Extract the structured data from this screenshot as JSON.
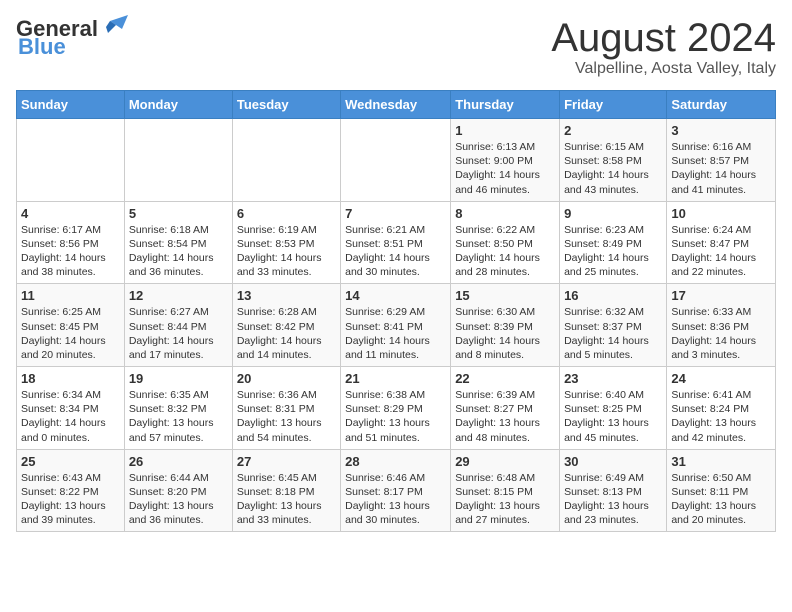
{
  "header": {
    "logo_general": "General",
    "logo_blue": "Blue",
    "month": "August 2024",
    "location": "Valpelline, Aosta Valley, Italy"
  },
  "days_of_week": [
    "Sunday",
    "Monday",
    "Tuesday",
    "Wednesday",
    "Thursday",
    "Friday",
    "Saturday"
  ],
  "weeks": [
    [
      {
        "num": "",
        "info": ""
      },
      {
        "num": "",
        "info": ""
      },
      {
        "num": "",
        "info": ""
      },
      {
        "num": "",
        "info": ""
      },
      {
        "num": "1",
        "info": "Sunrise: 6:13 AM\nSunset: 9:00 PM\nDaylight: 14 hours\nand 46 minutes."
      },
      {
        "num": "2",
        "info": "Sunrise: 6:15 AM\nSunset: 8:58 PM\nDaylight: 14 hours\nand 43 minutes."
      },
      {
        "num": "3",
        "info": "Sunrise: 6:16 AM\nSunset: 8:57 PM\nDaylight: 14 hours\nand 41 minutes."
      }
    ],
    [
      {
        "num": "4",
        "info": "Sunrise: 6:17 AM\nSunset: 8:56 PM\nDaylight: 14 hours\nand 38 minutes."
      },
      {
        "num": "5",
        "info": "Sunrise: 6:18 AM\nSunset: 8:54 PM\nDaylight: 14 hours\nand 36 minutes."
      },
      {
        "num": "6",
        "info": "Sunrise: 6:19 AM\nSunset: 8:53 PM\nDaylight: 14 hours\nand 33 minutes."
      },
      {
        "num": "7",
        "info": "Sunrise: 6:21 AM\nSunset: 8:51 PM\nDaylight: 14 hours\nand 30 minutes."
      },
      {
        "num": "8",
        "info": "Sunrise: 6:22 AM\nSunset: 8:50 PM\nDaylight: 14 hours\nand 28 minutes."
      },
      {
        "num": "9",
        "info": "Sunrise: 6:23 AM\nSunset: 8:49 PM\nDaylight: 14 hours\nand 25 minutes."
      },
      {
        "num": "10",
        "info": "Sunrise: 6:24 AM\nSunset: 8:47 PM\nDaylight: 14 hours\nand 22 minutes."
      }
    ],
    [
      {
        "num": "11",
        "info": "Sunrise: 6:25 AM\nSunset: 8:45 PM\nDaylight: 14 hours\nand 20 minutes."
      },
      {
        "num": "12",
        "info": "Sunrise: 6:27 AM\nSunset: 8:44 PM\nDaylight: 14 hours\nand 17 minutes."
      },
      {
        "num": "13",
        "info": "Sunrise: 6:28 AM\nSunset: 8:42 PM\nDaylight: 14 hours\nand 14 minutes."
      },
      {
        "num": "14",
        "info": "Sunrise: 6:29 AM\nSunset: 8:41 PM\nDaylight: 14 hours\nand 11 minutes."
      },
      {
        "num": "15",
        "info": "Sunrise: 6:30 AM\nSunset: 8:39 PM\nDaylight: 14 hours\nand 8 minutes."
      },
      {
        "num": "16",
        "info": "Sunrise: 6:32 AM\nSunset: 8:37 PM\nDaylight: 14 hours\nand 5 minutes."
      },
      {
        "num": "17",
        "info": "Sunrise: 6:33 AM\nSunset: 8:36 PM\nDaylight: 14 hours\nand 3 minutes."
      }
    ],
    [
      {
        "num": "18",
        "info": "Sunrise: 6:34 AM\nSunset: 8:34 PM\nDaylight: 14 hours\nand 0 minutes."
      },
      {
        "num": "19",
        "info": "Sunrise: 6:35 AM\nSunset: 8:32 PM\nDaylight: 13 hours\nand 57 minutes."
      },
      {
        "num": "20",
        "info": "Sunrise: 6:36 AM\nSunset: 8:31 PM\nDaylight: 13 hours\nand 54 minutes."
      },
      {
        "num": "21",
        "info": "Sunrise: 6:38 AM\nSunset: 8:29 PM\nDaylight: 13 hours\nand 51 minutes."
      },
      {
        "num": "22",
        "info": "Sunrise: 6:39 AM\nSunset: 8:27 PM\nDaylight: 13 hours\nand 48 minutes."
      },
      {
        "num": "23",
        "info": "Sunrise: 6:40 AM\nSunset: 8:25 PM\nDaylight: 13 hours\nand 45 minutes."
      },
      {
        "num": "24",
        "info": "Sunrise: 6:41 AM\nSunset: 8:24 PM\nDaylight: 13 hours\nand 42 minutes."
      }
    ],
    [
      {
        "num": "25",
        "info": "Sunrise: 6:43 AM\nSunset: 8:22 PM\nDaylight: 13 hours\nand 39 minutes."
      },
      {
        "num": "26",
        "info": "Sunrise: 6:44 AM\nSunset: 8:20 PM\nDaylight: 13 hours\nand 36 minutes."
      },
      {
        "num": "27",
        "info": "Sunrise: 6:45 AM\nSunset: 8:18 PM\nDaylight: 13 hours\nand 33 minutes."
      },
      {
        "num": "28",
        "info": "Sunrise: 6:46 AM\nSunset: 8:17 PM\nDaylight: 13 hours\nand 30 minutes."
      },
      {
        "num": "29",
        "info": "Sunrise: 6:48 AM\nSunset: 8:15 PM\nDaylight: 13 hours\nand 27 minutes."
      },
      {
        "num": "30",
        "info": "Sunrise: 6:49 AM\nSunset: 8:13 PM\nDaylight: 13 hours\nand 23 minutes."
      },
      {
        "num": "31",
        "info": "Sunrise: 6:50 AM\nSunset: 8:11 PM\nDaylight: 13 hours\nand 20 minutes."
      }
    ]
  ]
}
